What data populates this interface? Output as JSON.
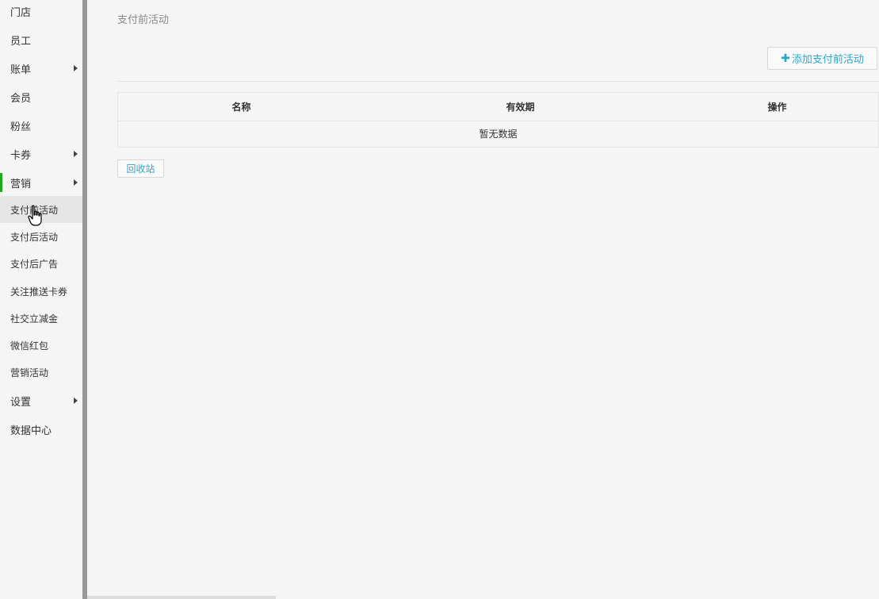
{
  "sidebar": {
    "items": [
      {
        "label": "门店",
        "has_submenu": false
      },
      {
        "label": "员工",
        "has_submenu": false
      },
      {
        "label": "账单",
        "has_submenu": true
      },
      {
        "label": "会员",
        "has_submenu": false
      },
      {
        "label": "粉丝",
        "has_submenu": false
      },
      {
        "label": "卡券",
        "has_submenu": true
      },
      {
        "label": "营销",
        "has_submenu": true,
        "active": true
      },
      {
        "label": "设置",
        "has_submenu": true
      },
      {
        "label": "数据中心",
        "has_submenu": false
      }
    ],
    "marketing_subitems": [
      {
        "label": "支付前活动",
        "selected": true
      },
      {
        "label": "支付后活动"
      },
      {
        "label": "支付后广告"
      },
      {
        "label": "关注推送卡券"
      },
      {
        "label": "社交立减金"
      },
      {
        "label": "微信红包"
      },
      {
        "label": "营销活动"
      }
    ],
    "accent_color": "#1aad19"
  },
  "main": {
    "breadcrumb": "支付前活动",
    "add_button": {
      "icon": "plus-icon",
      "label": "添加支付前活动"
    },
    "table": {
      "columns": [
        "名称",
        "有效期",
        "操作"
      ],
      "empty_text": "暂无数据"
    },
    "recycle_button": "回收站",
    "link_color": "#2ba6cb"
  }
}
